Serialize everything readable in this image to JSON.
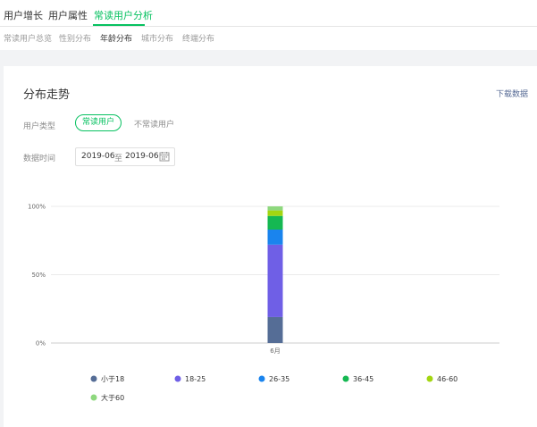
{
  "main_tabs": [
    {
      "label": "用户增长",
      "active": false
    },
    {
      "label": "用户属性",
      "active": false
    },
    {
      "label": "常读用户分析",
      "active": true
    }
  ],
  "sub_tabs": [
    {
      "label": "常读用户总览",
      "active": false
    },
    {
      "label": "性别分布",
      "active": false
    },
    {
      "label": "年龄分布",
      "active": true
    },
    {
      "label": "城市分布",
      "active": false
    },
    {
      "label": "终端分布",
      "active": false
    }
  ],
  "card": {
    "title": "分布走势",
    "download_label": "下载数据",
    "user_type_label": "用户类型",
    "user_types": {
      "selected": "常读用户",
      "other": "不常读用户"
    },
    "date_label": "数据时间",
    "date_from": "2019-06",
    "date_sep": "至",
    "date_to": "2019-06",
    "calendar_icon": "calendar-icon"
  },
  "colors": {
    "accent": "#07c160",
    "link": "#576b95"
  },
  "chart_data": {
    "type": "bar",
    "stacked": true,
    "categories": [
      "6月"
    ],
    "y_ticks": [
      "100%",
      "50%",
      "0%"
    ],
    "ylim": [
      0,
      100
    ],
    "grid": true,
    "legend_position": "bottom",
    "series": [
      {
        "name": "小于18",
        "color": "#556d96",
        "values": [
          19
        ]
      },
      {
        "name": "18-25",
        "color": "#6f5fe6",
        "values": [
          53
        ]
      },
      {
        "name": "26-35",
        "color": "#1a84ee",
        "values": [
          11
        ]
      },
      {
        "name": "36-45",
        "color": "#15b852",
        "values": [
          10
        ]
      },
      {
        "name": "46-60",
        "color": "#a3d611",
        "values": [
          4
        ]
      },
      {
        "name": "大于60",
        "color": "#8ed87e",
        "values": [
          3
        ]
      }
    ]
  }
}
